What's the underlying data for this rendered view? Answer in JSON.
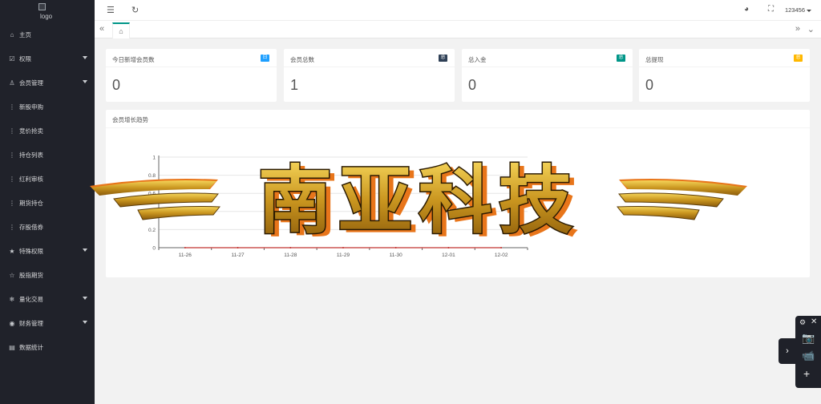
{
  "sidebar": {
    "logo_alt": "logo",
    "items": [
      {
        "label": "主页",
        "icon": "home-icon",
        "glyph": "⌂",
        "expand": false
      },
      {
        "label": "权限",
        "icon": "shield-check-icon",
        "glyph": "☑",
        "expand": true
      },
      {
        "label": "会员管理",
        "icon": "user-icon",
        "glyph": "♙",
        "expand": true
      },
      {
        "label": "新股申购",
        "icon": "vertical-dots-icon",
        "glyph": "⋮",
        "expand": false
      },
      {
        "label": "竞价抢卖",
        "icon": "vertical-dots-icon",
        "glyph": "⋮",
        "expand": false
      },
      {
        "label": "持仓列表",
        "icon": "vertical-dots-icon",
        "glyph": "⋮",
        "expand": false
      },
      {
        "label": "红利审核",
        "icon": "vertical-dots-icon",
        "glyph": "⋮",
        "expand": false
      },
      {
        "label": "期货持仓",
        "icon": "vertical-dots-icon",
        "glyph": "⋮",
        "expand": false
      },
      {
        "label": "存股借券",
        "icon": "vertical-dots-icon",
        "glyph": "⋮",
        "expand": false
      },
      {
        "label": "特殊权限",
        "icon": "star-icon",
        "glyph": "★",
        "expand": true
      },
      {
        "label": "股指期货",
        "icon": "star-outline-icon",
        "glyph": "☆",
        "expand": false
      },
      {
        "label": "量化交易",
        "icon": "snowflake-icon",
        "glyph": "❄",
        "expand": true
      },
      {
        "label": "财务管理",
        "icon": "circle-dot-icon",
        "glyph": "◉",
        "expand": true
      },
      {
        "label": "数据统计",
        "icon": "chart-table-icon",
        "glyph": "▤",
        "expand": false
      }
    ]
  },
  "header": {
    "menu_icon": "hamburger-menu-icon",
    "refresh_icon": "refresh-icon",
    "theme_icon": "palette-icon",
    "fullscreen_icon": "fullscreen-icon",
    "username": "123456"
  },
  "tabbar": {
    "home_icon": "home-icon"
  },
  "cards": [
    {
      "title": "今日新增会员数",
      "badge": "日",
      "badge_color": "#1e9fff",
      "value": "0"
    },
    {
      "title": "会员总数",
      "badge": "总",
      "badge_color": "#2f4056",
      "value": "1"
    },
    {
      "title": "总入金",
      "badge": "总",
      "badge_color": "#009688",
      "value": "0"
    },
    {
      "title": "总提现",
      "badge": "总",
      "badge_color": "#ffb800",
      "value": "0"
    }
  ],
  "chart_panel": {
    "title": "会员增长趋势"
  },
  "chart_data": {
    "type": "line",
    "categories": [
      "11-26",
      "11-27",
      "11-28",
      "11-29",
      "11-30",
      "12-01",
      "12-02"
    ],
    "series": [
      {
        "values": [
          0,
          0,
          0,
          0,
          0,
          0,
          0
        ],
        "color": "#c23531"
      }
    ],
    "ylim": [
      0,
      1
    ],
    "yticks": [
      "0",
      "0.2",
      "0.4",
      "0.6",
      "0.8",
      "1"
    ],
    "grid": true
  },
  "watermark": {
    "text": "南亚科技"
  },
  "float_toolbar": {
    "settings_icon": "gear-icon",
    "close_icon": "close-icon",
    "screenshot_icon": "camera-icon",
    "record_icon": "video-camera-icon",
    "add_icon": "plus-icon",
    "expand_icon": "chevron-right-icon"
  }
}
